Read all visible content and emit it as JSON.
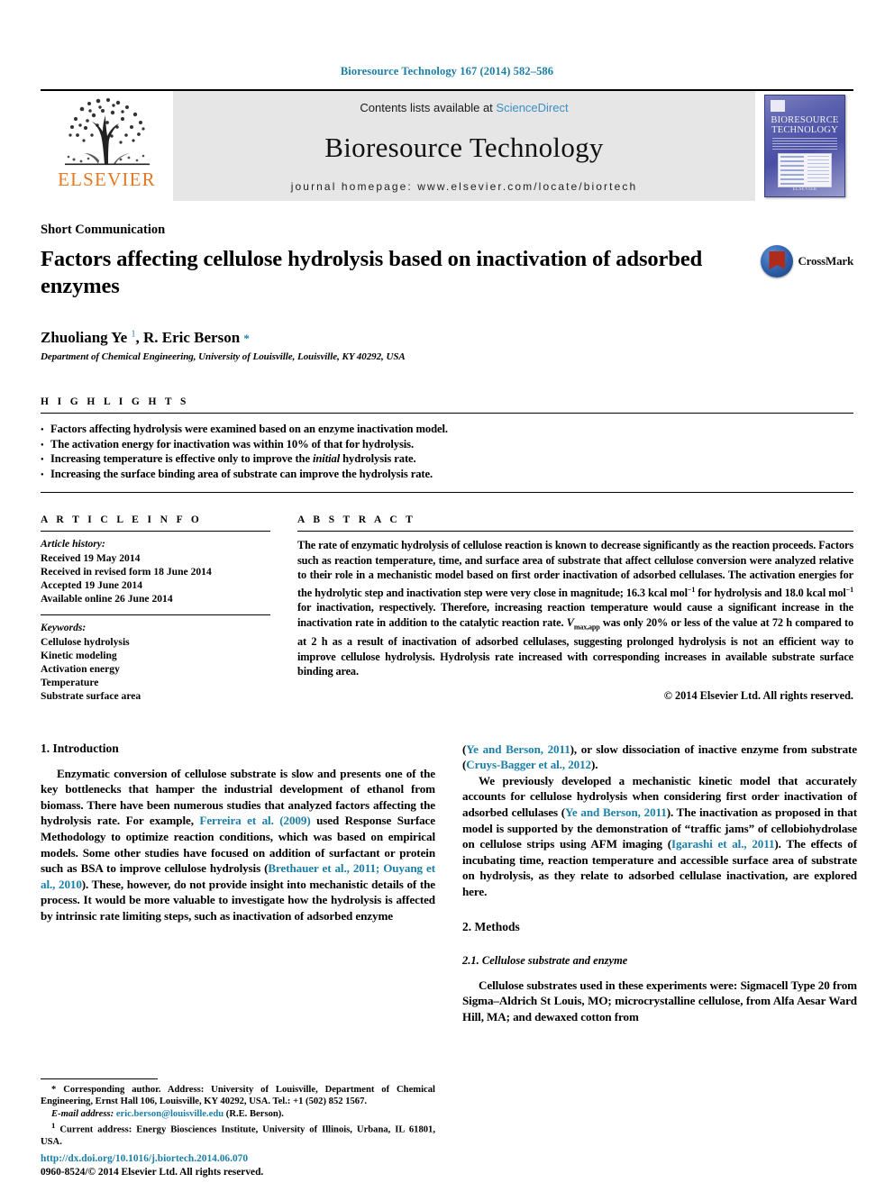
{
  "running_head": "Bioresource Technology 167 (2014) 582–586",
  "masthead": {
    "publisher_name": "ELSEVIER",
    "contents_prefix": "Contents lists available at ",
    "contents_link": "ScienceDirect",
    "journal_title": "Bioresource Technology",
    "homepage": "journal homepage: www.elsevier.com/locate/biortech",
    "cover": {
      "title_line1": "BIORESOURCE",
      "title_line2": "TECHNOLOGY",
      "footer": "ELSEVIER"
    }
  },
  "article": {
    "section_type": "Short Communication",
    "title": "Factors affecting cellulose hydrolysis based on inactivation of adsorbed enzymes",
    "crossmark_label": "CrossMark",
    "authors_html": "Zhuoliang Ye <sup>1</sup>, R. Eric Berson <span class=\"star\">*</span>",
    "affiliation": "Department of Chemical Engineering, University of Louisville, Louisville, KY 40292, USA"
  },
  "highlights": {
    "label": "H I G H L I G H T S",
    "items": [
      "Factors affecting hydrolysis were examined based on an enzyme inactivation model.",
      "The activation energy for inactivation was within 10% of that for hydrolysis.",
      "Increasing temperature is effective only to improve the <i>initial</i> hydrolysis rate.",
      "Increasing the surface binding area of substrate can improve the hydrolysis rate."
    ]
  },
  "article_info": {
    "label": "A R T I C L E    I N F O",
    "history_label": "Article history:",
    "history": [
      "Received 19 May 2014",
      "Received in revised form 18 June 2014",
      "Accepted 19 June 2014",
      "Available online 26 June 2014"
    ],
    "keywords_label": "Keywords:",
    "keywords": [
      "Cellulose hydrolysis",
      "Kinetic modeling",
      "Activation energy",
      "Temperature",
      "Substrate surface area"
    ]
  },
  "abstract": {
    "label": "A B S T R A C T",
    "text_html": "The rate of enzymatic hydrolysis of cellulose reaction is known to decrease significantly as the reaction proceeds. Factors such as reaction temperature, time, and surface area of substrate that affect cellulose conversion were analyzed relative to their role in a mechanistic model based on first order inactivation of adsorbed cellulases. The activation energies for the hydrolytic step and inactivation step were very close in magnitude; 16.3 kcal mol<sup>−1</sup> for hydrolysis and 18.0 kcal mol<sup>−1</sup> for inactivation, respectively. Therefore, increasing reaction temperature would cause a significant increase in the inactivation rate in addition to the catalytic reaction rate. <i>V</i><sub>max,app</sub> was only 20% or less of the value at 72 h compared to at 2 h as a result of inactivation of adsorbed cellulases, suggesting prolonged hydrolysis is not an efficient way to improve cellulose hydrolysis. Hydrolysis rate increased with corresponding increases in available substrate surface binding area.",
    "copyright": "© 2014 Elsevier Ltd. All rights reserved."
  },
  "body": {
    "left": {
      "heading": "1. Introduction",
      "paragraph_html": "Enzymatic conversion of cellulose substrate is slow and presents one of the key bottlenecks that hamper the industrial development of ethanol from biomass. There have been numerous studies that analyzed factors affecting the hydrolysis rate. For example, <span class=\"lnk\">Ferreira et al. (2009)</span> used Response Surface Methodology to optimize reaction conditions, which was based on empirical models. Some other studies have focused on addition of surfactant or protein such as BSA to improve cellulose hydrolysis (<span class=\"lnk\">Brethauer et al., 2011; Ouyang et al., 2010</span>). These, however, do not provide insight into mechanistic details of the process. It would be more valuable to investigate how the hydrolysis is affected by intrinsic rate limiting steps, such as inactivation of adsorbed enzyme"
    },
    "right": {
      "paragraph1_html": "(<span class=\"lnk\">Ye and Berson, 2011</span>), or slow dissociation of inactive enzyme from substrate (<span class=\"lnk\">Cruys-Bagger et al., 2012</span>).",
      "paragraph2_html": "We previously developed a mechanistic kinetic model that accurately accounts for cellulose hydrolysis when considering first order inactivation of adsorbed cellulases (<span class=\"lnk\">Ye and Berson, 2011</span>). The inactivation as proposed in that model is supported by the demonstration of &ldquo;traffic jams&rdquo; of cellobiohydrolase on cellulose strips using AFM imaging (<span class=\"lnk\">Igarashi et al., 2011</span>). The effects of incubating time, reaction temperature and accessible surface area of substrate on hydrolysis, as they relate to adsorbed cellulase inactivation, are explored here.",
      "methods_heading": "2. Methods",
      "subheading": "2.1. Cellulose substrate and enzyme",
      "paragraph3_html": "Cellulose substrates used in these experiments were: Sigmacell Type 20 from Sigma&ndash;Aldrich St Louis, MO; microcrystalline cellulose, from Alfa Aesar Ward Hill, MA; and dewaxed cotton from"
    }
  },
  "footnotes": {
    "corresponding_html": "<span class=\"star\">*</span> Corresponding author. Address: University of Louisville, Department of Chemical Engineering, Ernst Hall 106, Louisville, KY 40292, USA. Tel.: +1 (502) 852 1567.",
    "email_html": "<span class=\"ital\">E-mail address:</span> <span class=\"lnk\">eric.berson@louisville.edu</span> (R.E. Berson).",
    "note1_html": "<sup>1</sup> Current address: Energy Biosciences Institute, University of Illinois, Urbana, IL 61801, USA."
  },
  "footer": {
    "doi": "http://dx.doi.org/10.1016/j.biortech.2014.06.070",
    "issn": "0960-8524/© 2014 Elsevier Ltd. All rights reserved."
  },
  "colors": {
    "link": "#1a7fa8",
    "sciencedirect": "#3b8fc4",
    "elsevier_orange": "#E87722",
    "masthead_bg": "#e6e6e6"
  }
}
